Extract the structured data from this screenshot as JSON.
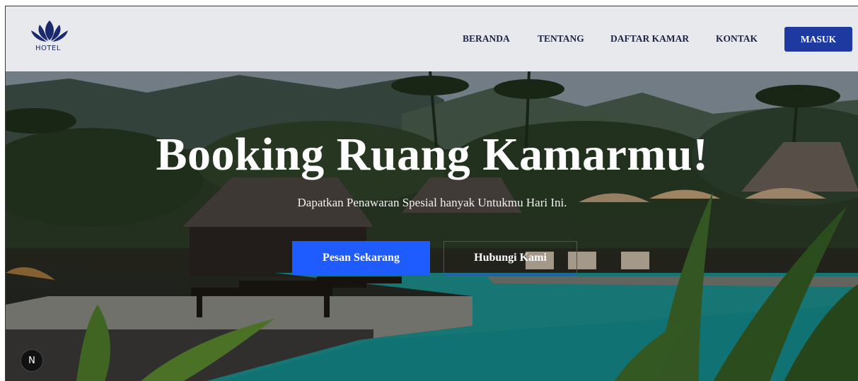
{
  "navbar": {
    "logo_text": "HOTEL",
    "links": [
      "BERANDA",
      "TENTANG",
      "DAFTAR KAMAR",
      "KONTAK"
    ],
    "login_label": "MASUK"
  },
  "hero": {
    "title": "Booking Ruang Kamarmu!",
    "subtitle": "Dapatkan Penawaran Spesial hanyak Untukmu Hari Ini.",
    "primary_cta": "Pesan Sekarang",
    "secondary_cta": "Hubungi Kami"
  },
  "badge": {
    "label": "N"
  },
  "colors": {
    "navbar_bg": "#e8e9ed",
    "brand_blue": "#1e3aa0",
    "cta_blue": "#1f5cff",
    "nav_text": "#1b2440"
  }
}
